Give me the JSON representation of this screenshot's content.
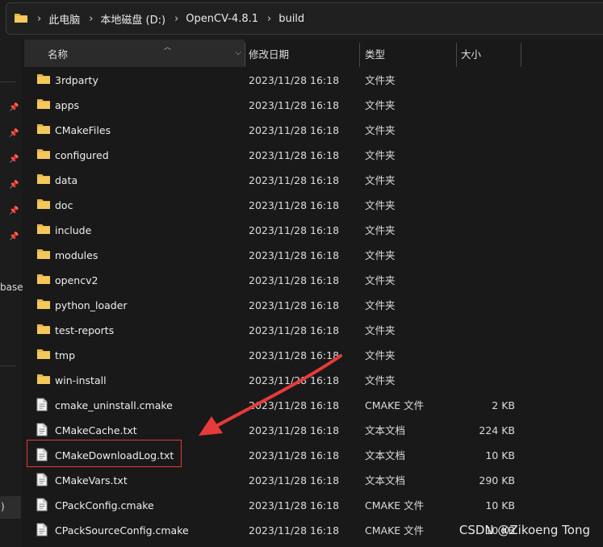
{
  "breadcrumb": [
    "此电脑",
    "本地磁盘 (D:)",
    "OpenCV-4.8.1",
    "build"
  ],
  "columns": {
    "name": "名称",
    "date": "修改日期",
    "type": "类型",
    "size": "大小"
  },
  "sidebar": {
    "partial_label": "base",
    "partial_box": ")"
  },
  "rows": [
    {
      "icon": "folder-icon",
      "name": "3rdparty",
      "date": "2023/11/28 16:18",
      "type": "文件夹",
      "size": ""
    },
    {
      "icon": "folder-icon",
      "name": "apps",
      "date": "2023/11/28 16:18",
      "type": "文件夹",
      "size": ""
    },
    {
      "icon": "folder-icon",
      "name": "CMakeFiles",
      "date": "2023/11/28 16:18",
      "type": "文件夹",
      "size": ""
    },
    {
      "icon": "folder-icon",
      "name": "configured",
      "date": "2023/11/28 16:18",
      "type": "文件夹",
      "size": ""
    },
    {
      "icon": "folder-icon",
      "name": "data",
      "date": "2023/11/28 16:18",
      "type": "文件夹",
      "size": ""
    },
    {
      "icon": "folder-icon",
      "name": "doc",
      "date": "2023/11/28 16:18",
      "type": "文件夹",
      "size": ""
    },
    {
      "icon": "folder-icon",
      "name": "include",
      "date": "2023/11/28 16:18",
      "type": "文件夹",
      "size": ""
    },
    {
      "icon": "folder-icon",
      "name": "modules",
      "date": "2023/11/28 16:18",
      "type": "文件夹",
      "size": ""
    },
    {
      "icon": "folder-icon",
      "name": "opencv2",
      "date": "2023/11/28 16:18",
      "type": "文件夹",
      "size": ""
    },
    {
      "icon": "folder-icon",
      "name": "python_loader",
      "date": "2023/11/28 16:18",
      "type": "文件夹",
      "size": ""
    },
    {
      "icon": "folder-icon",
      "name": "test-reports",
      "date": "2023/11/28 16:18",
      "type": "文件夹",
      "size": ""
    },
    {
      "icon": "folder-icon",
      "name": "tmp",
      "date": "2023/11/28 16:18",
      "type": "文件夹",
      "size": ""
    },
    {
      "icon": "folder-icon",
      "name": "win-install",
      "date": "2023/11/28 16:18",
      "type": "文件夹",
      "size": ""
    },
    {
      "icon": "file-icon",
      "name": "cmake_uninstall.cmake",
      "date": "2023/11/28 16:18",
      "type": "CMAKE 文件",
      "size": "2 KB"
    },
    {
      "icon": "file-icon",
      "name": "CMakeCache.txt",
      "date": "2023/11/28 16:18",
      "type": "文本文档",
      "size": "224 KB"
    },
    {
      "icon": "file-icon",
      "name": "CMakeDownloadLog.txt",
      "date": "2023/11/28 16:18",
      "type": "文本文档",
      "size": "10 KB"
    },
    {
      "icon": "file-icon",
      "name": "CMakeVars.txt",
      "date": "2023/11/28 16:18",
      "type": "文本文档",
      "size": "290 KB"
    },
    {
      "icon": "file-icon",
      "name": "CPackConfig.cmake",
      "date": "2023/11/28 16:18",
      "type": "CMAKE 文件",
      "size": "10 KB"
    },
    {
      "icon": "file-icon",
      "name": "CPackSourceConfig.cmake",
      "date": "2023/11/28 16:18",
      "type": "CMAKE 文件",
      "size": "10 KB"
    }
  ],
  "annotation": {
    "highlighted_row": "CMakeDownloadLog.txt",
    "color": "#e83a3a"
  },
  "watermark": "CSDN @Zikoeng Tong"
}
